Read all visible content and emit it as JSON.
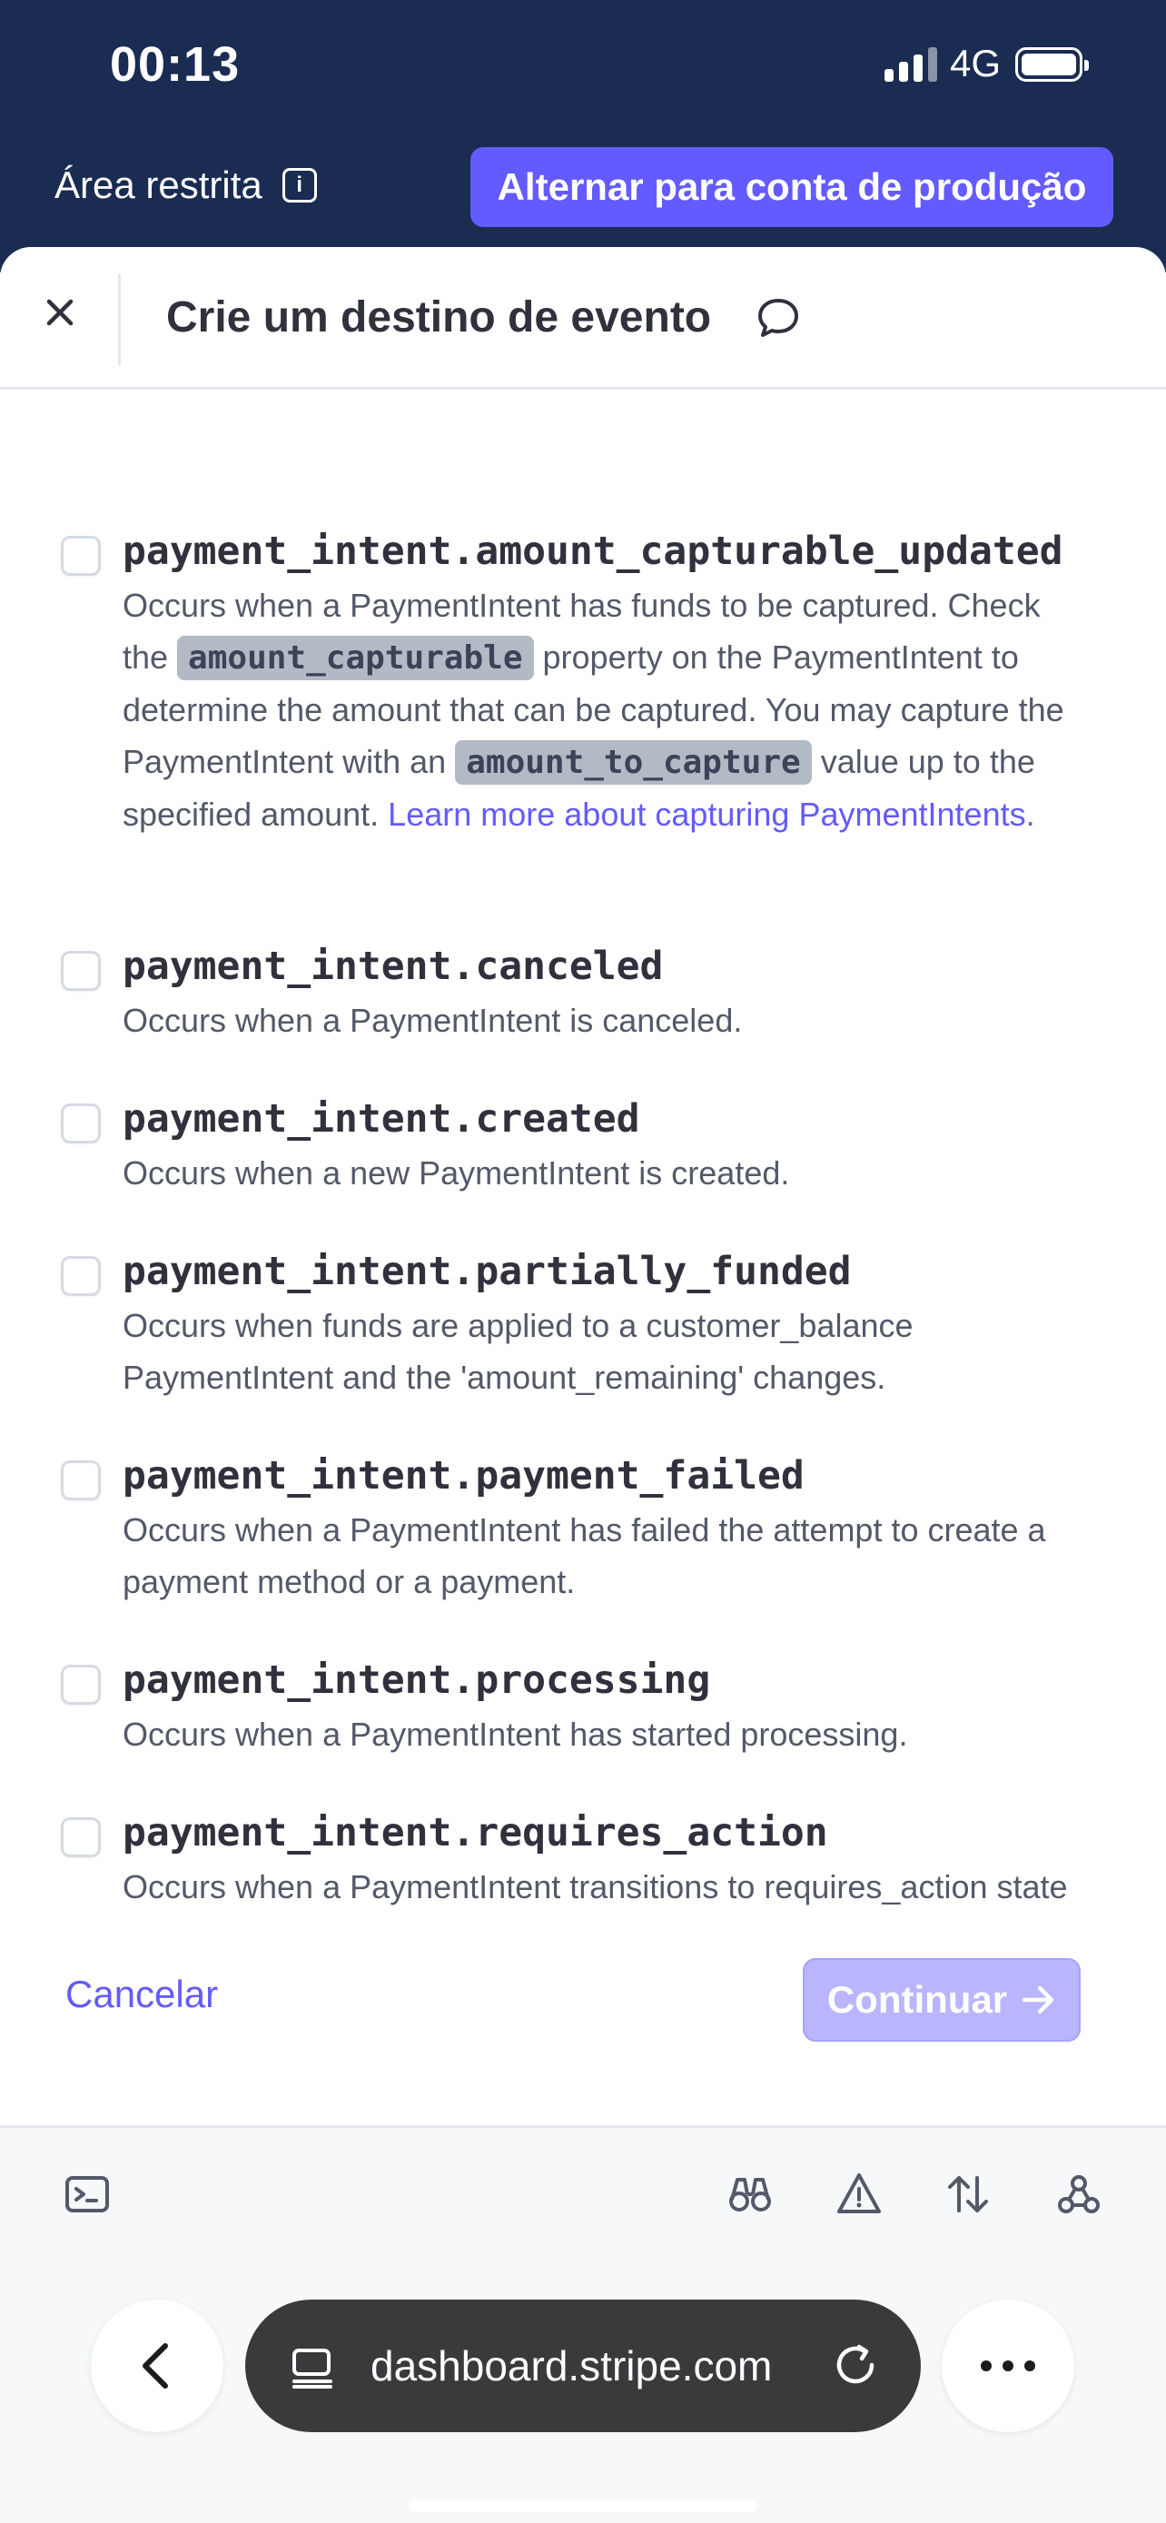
{
  "status_bar": {
    "time": "00:13",
    "network": "4G"
  },
  "sandbox": {
    "label": "Área restrita",
    "switch_button": "Alternar para conta de produção"
  },
  "sheet": {
    "title": "Crie um destino de evento"
  },
  "events": [
    {
      "name": "payment_intent.amount_capturable_updated",
      "desc_part1": "Occurs when a PaymentIntent has funds to be captured. Check the ",
      "code1": "amount_capturable",
      "desc_part2": " property on the PaymentIntent to determine the amount that can be captured. You may capture the PaymentIntent with an ",
      "code2": "amount_to_capture",
      "desc_part3": " value up to the specified amount. ",
      "link": "Learn more about capturing PaymentIntents."
    },
    {
      "name": "payment_intent.canceled",
      "description": "Occurs when a PaymentIntent is canceled."
    },
    {
      "name": "payment_intent.created",
      "description": "Occurs when a new PaymentIntent is created."
    },
    {
      "name": "payment_intent.partially_funded",
      "description": "Occurs when funds are applied to a customer_balance PaymentIntent and the 'amount_remaining' changes."
    },
    {
      "name": "payment_intent.payment_failed",
      "description": "Occurs when a PaymentIntent has failed the attempt to create a payment method or a payment."
    },
    {
      "name": "payment_intent.processing",
      "description": "Occurs when a PaymentIntent has started processing."
    },
    {
      "name": "payment_intent.requires_action",
      "description": "Occurs when a PaymentIntent transitions to requires_action state"
    }
  ],
  "footer": {
    "cancel": "Cancelar",
    "continue": "Continuar"
  },
  "browser": {
    "url": "dashboard.stripe.com"
  },
  "colors": {
    "accent": "#635bff",
    "header_bg": "#1a2c52",
    "disabled_button": "#b9b5ff"
  }
}
